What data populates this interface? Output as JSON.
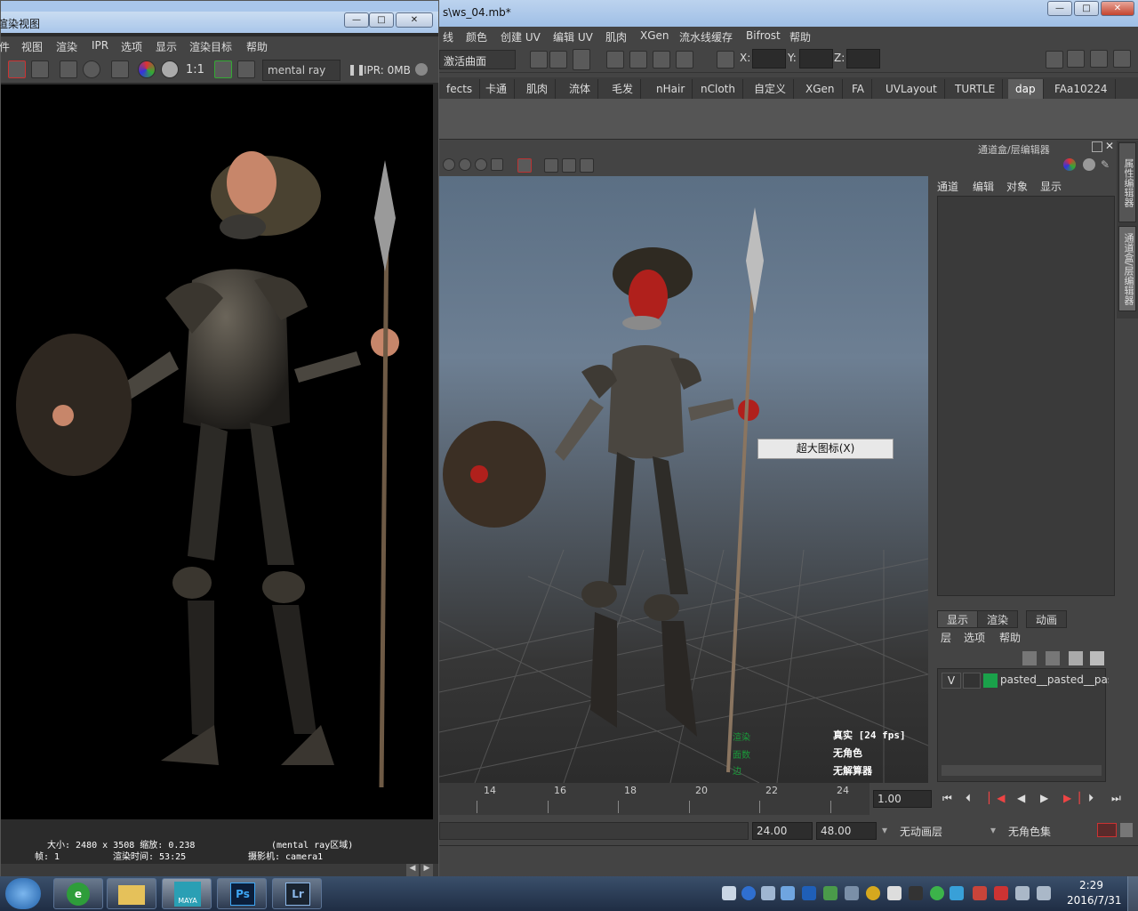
{
  "maya": {
    "title": "s\\ws_04.mb*",
    "window_buttons": [
      "—",
      "□",
      "✕"
    ],
    "menu": [
      "线",
      "颜色",
      "创建 UV",
      "编辑 UV",
      "肌肉",
      "XGen",
      "流水线缓存",
      "Bifrost",
      "帮助"
    ],
    "status": {
      "mode_label": "激活曲面",
      "x_label": "X:",
      "y_label": "Y:",
      "z_label": "Z:"
    },
    "shelf_tabs": [
      "fects",
      "卡通",
      "肌肉",
      "流体",
      "毛发",
      "nHair",
      "nCloth",
      "自定义",
      "XGen",
      "FA",
      "UVLayout",
      "TURTLE",
      "dap",
      "FAa10224"
    ],
    "shelf_active": "dap",
    "context_menu": "超大图标(X)",
    "hud": {
      "fps": "真实 [24 fps]",
      "no_char": "无角色",
      "no_keys": "无解算器",
      "green1": "渲染",
      "green2": "面数",
      "green3": "边"
    },
    "channel_box": {
      "title": "通道盒/层编辑器",
      "menu": [
        "通道",
        "编辑",
        "对象",
        "显示"
      ],
      "layer_tabs": [
        "显示",
        "渲染",
        "动画"
      ],
      "layer_menu": [
        "层",
        "选项",
        "帮助"
      ],
      "layer_row": {
        "visible": "V",
        "name": "pasted__pasted__pas"
      }
    },
    "side_tabs": [
      "属性编辑器",
      "通道盒/层编辑器"
    ],
    "timeline": {
      "ticks": [
        "14",
        "16",
        "18",
        "20",
        "22",
        "24"
      ],
      "current": "1.00"
    },
    "range": {
      "end": "24.00",
      "total": "48.00",
      "anim_layer": "无动画层",
      "char_set": "无角色集"
    }
  },
  "render_view": {
    "title": "渲染视图",
    "menu": [
      "件",
      "视图",
      "渲染",
      "IPR",
      "选项",
      "显示",
      "渲染目标",
      "帮助"
    ],
    "renderer": "mental ray",
    "ipr_mem": "IPR: 0MB",
    "ratio": "1:1",
    "info": {
      "size": "大小: 2480 x 3508 缩放: 0.238",
      "region": "(mental ray区域)",
      "frame": "帧: 1",
      "time": "渲染时间: 53:25",
      "camera": "摄影机: camera1"
    }
  },
  "taskbar": {
    "apps": [
      "start-orb",
      "ie",
      "explorer",
      "maya",
      "photoshop",
      "lightroom"
    ],
    "app_labels": {
      "maya": "MAYA",
      "ps": "Ps",
      "lr": "Lr"
    },
    "clock_time": "2:29",
    "clock_date": "2016/7/31"
  },
  "colors": {
    "maya_bg": "#444444",
    "accent_green": "#1aa14a",
    "viewport_sky": "#6d7f93"
  }
}
